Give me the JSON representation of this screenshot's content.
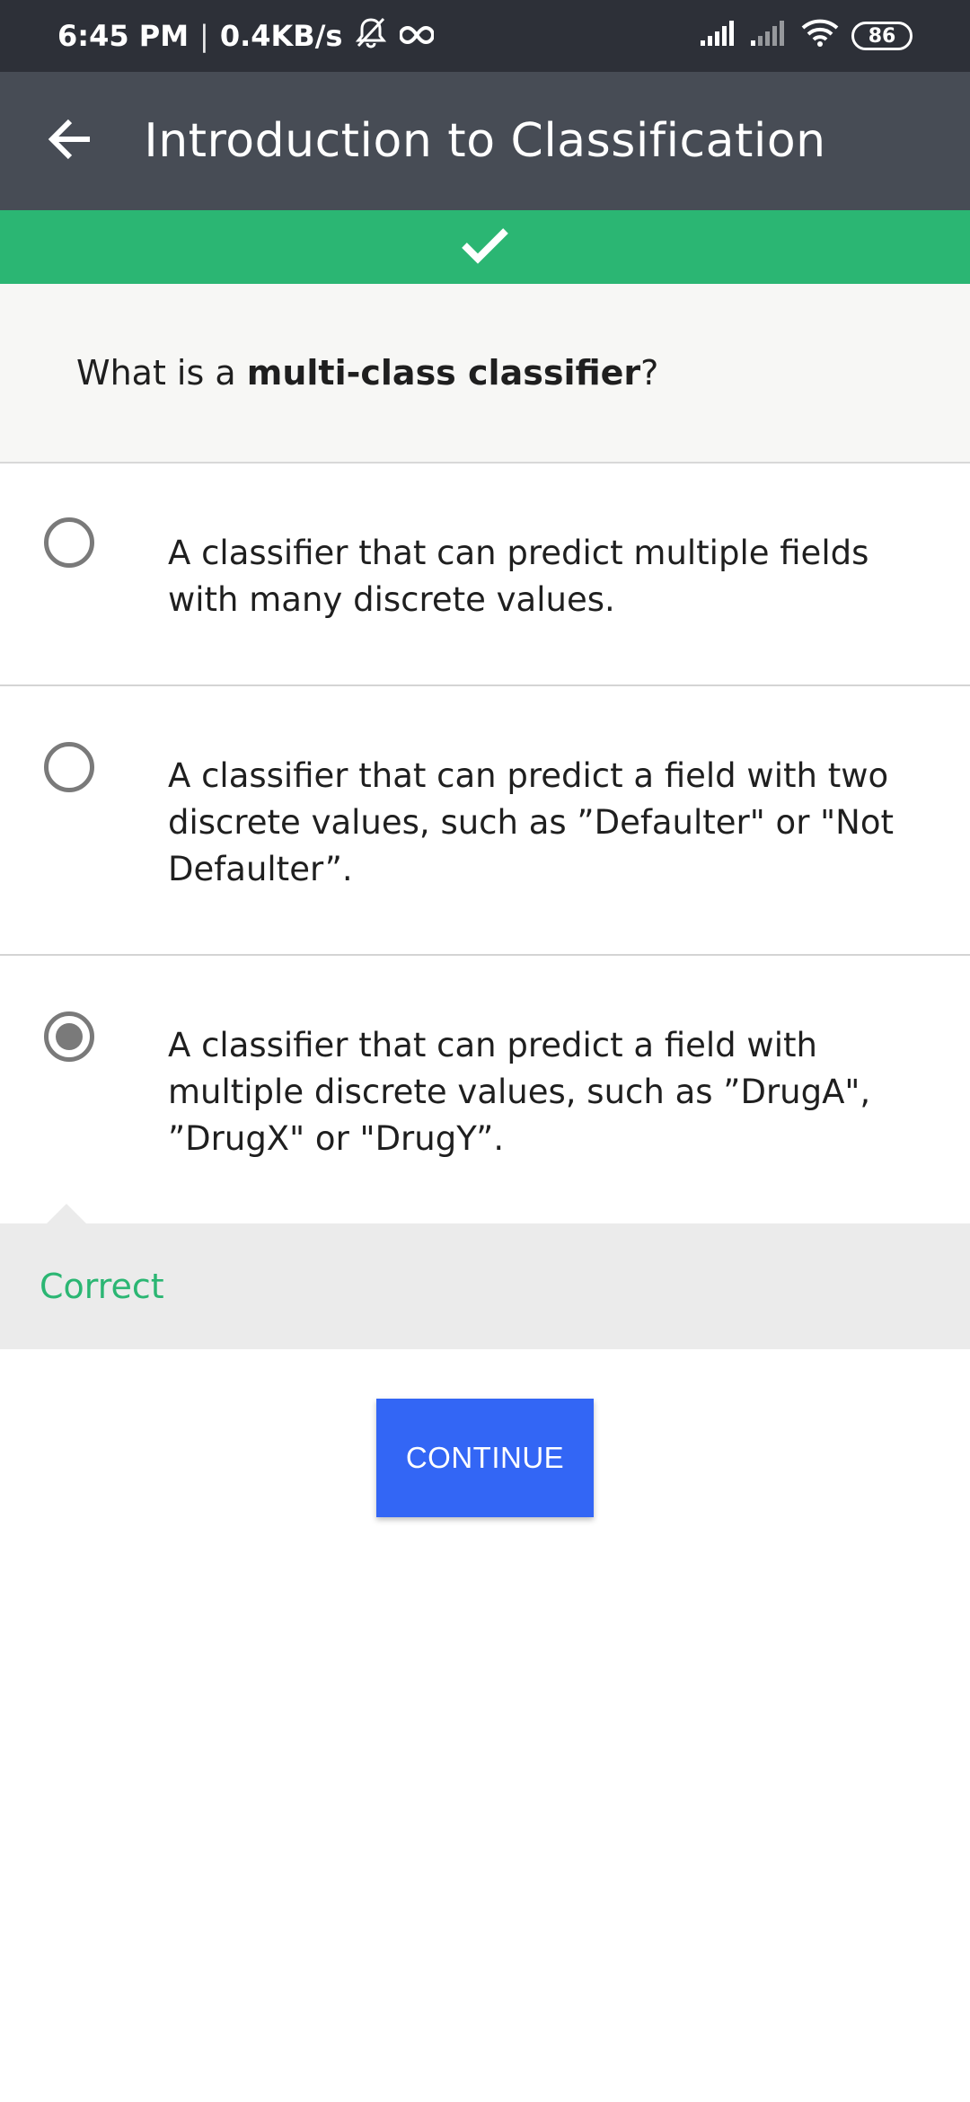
{
  "status_bar": {
    "time": "6:45 PM",
    "separator": "|",
    "network_speed": "0.4KB/s",
    "icons": [
      "mute-icon",
      "infinity-icon",
      "signal-icon",
      "signal-weak-icon",
      "wifi-icon"
    ],
    "battery": "86"
  },
  "app_bar": {
    "back_icon": "arrow-left-icon",
    "title": "Introduction to Classification"
  },
  "progress": {
    "icon": "checkmark-icon",
    "color": "#2bb673"
  },
  "question": {
    "prefix": "What is a ",
    "emphasis": "multi-class classifier",
    "suffix": "?"
  },
  "options": [
    {
      "text": "A classifier that can predict multiple fields with many discrete values.",
      "selected": false
    },
    {
      "text": "A classifier that can predict a field with two discrete values, such as ”Defaulter\" or \"Not Defaulter”.",
      "selected": false
    },
    {
      "text": "A classifier that can predict a field with multiple discrete values, such as ”DrugA\", ”DrugX\" or \"DrugY”.",
      "selected": true
    }
  ],
  "feedback": {
    "label": "Correct",
    "color": "#2bb673"
  },
  "continue_button": {
    "label": "CONTINUE",
    "color": "#3366f5"
  }
}
